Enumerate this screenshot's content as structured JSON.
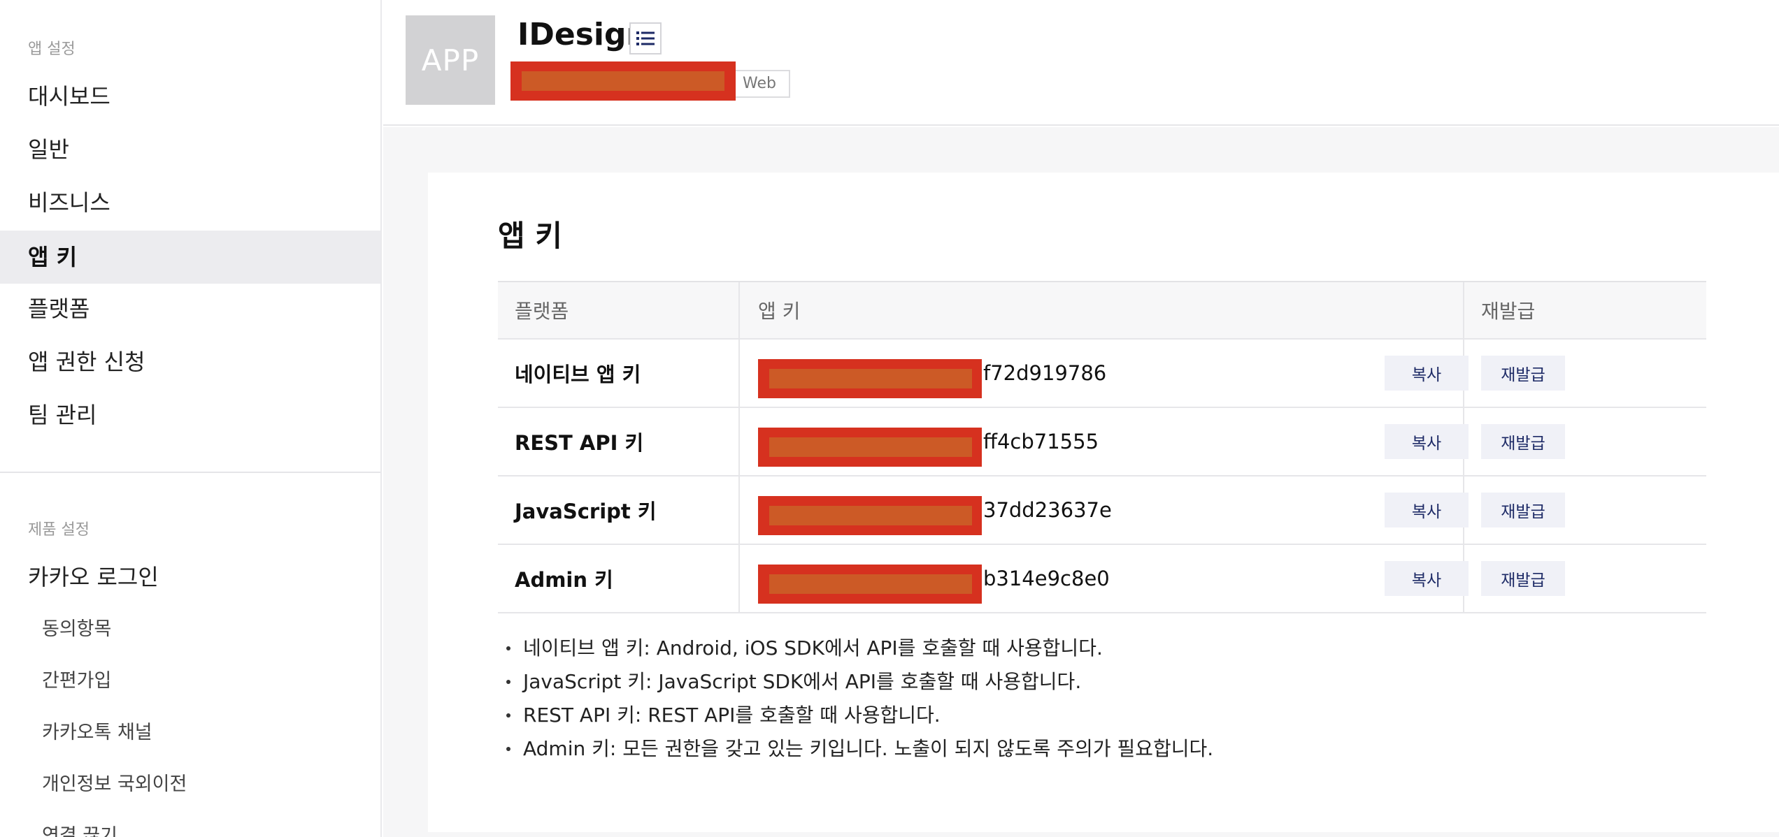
{
  "sidebar": {
    "app_settings_title": "앱 설정",
    "items": [
      {
        "label": "대시보드"
      },
      {
        "label": "일반"
      },
      {
        "label": "비즈니스"
      },
      {
        "label": "앱 키"
      },
      {
        "label": "플랫폼"
      },
      {
        "label": "앱 권한 신청"
      },
      {
        "label": "팀 관리"
      }
    ],
    "active_item": "앱 키",
    "product_settings_title": "제품 설정",
    "product_items": [
      {
        "label": "카카오 로그인"
      }
    ],
    "sub_items": [
      {
        "label": "동의항목"
      },
      {
        "label": "간편가입"
      },
      {
        "label": "카카오톡 채널"
      },
      {
        "label": "개인정보 국외이전"
      },
      {
        "label": "연결 끊기"
      }
    ]
  },
  "header": {
    "thumb_text": "APP",
    "app_name": "IDesign",
    "platform_tag": "Web"
  },
  "main": {
    "title": "앱 키",
    "table": {
      "columns": [
        "플랫폼",
        "앱 키",
        "재발급"
      ],
      "rows": [
        {
          "platform": "네이티브 앱 키",
          "key_suffix": "f72d919786",
          "copy": "복사",
          "reissue": "재발급"
        },
        {
          "platform": "REST API 키",
          "key_suffix": "ff4cb71555",
          "copy": "복사",
          "reissue": "재발급"
        },
        {
          "platform": "JavaScript 키",
          "key_suffix": "37dd23637e",
          "copy": "복사",
          "reissue": "재발급"
        },
        {
          "platform": "Admin 키",
          "key_suffix": "b314e9c8e0",
          "copy": "복사",
          "reissue": "재발급"
        }
      ]
    },
    "notes": [
      "네이티브 앱 키: Android, iOS SDK에서 API를 호출할 때 사용합니다.",
      "JavaScript 키: JavaScript SDK에서 API를 호출할 때 사용합니다.",
      "REST API 키: REST API를 호출할 때 사용합니다.",
      "Admin 키: 모든 권한을 갖고 있는 키입니다. 노출이 되지 않도록 주의가 필요합니다."
    ]
  },
  "colors": {
    "accent_text": "#1d2a66",
    "button_bg": "#f0f1f7",
    "active_bg": "#ececef",
    "redaction": "#d6311f"
  },
  "icons": {
    "list_button": "list-icon"
  }
}
